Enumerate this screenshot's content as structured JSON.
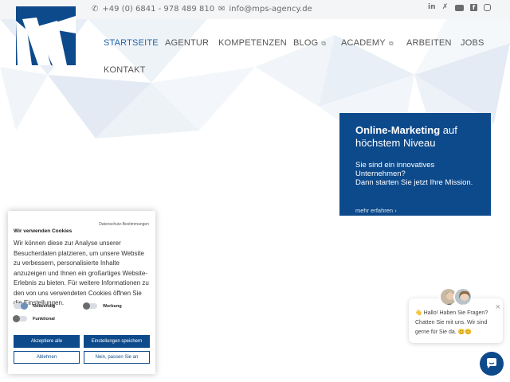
{
  "topbar": {
    "phone": "+49 (0) 6841 - 978 489 810",
    "email": "info@mps-agency.de",
    "social": [
      "linkedin-icon",
      "xing-icon",
      "youtube-icon",
      "facebook-icon",
      "instagram-icon"
    ]
  },
  "nav": {
    "items": [
      {
        "label": "STARTSEITE",
        "active": true
      },
      {
        "label": "AGENTUR"
      },
      {
        "label": "KOMPETENZEN"
      },
      {
        "label": "BLOG",
        "external": true
      },
      {
        "label": "ACADEMY",
        "external": true
      },
      {
        "label": "ARBEITEN"
      },
      {
        "label": "JOBS"
      },
      {
        "label": "KONTAKT"
      }
    ]
  },
  "hero": {
    "title_bold": "Online-Marketing",
    "title_rest": " auf höchstem Niveau",
    "text_line1": "Sie sind ein innovatives Unternehmen?",
    "text_line2": "Dann starten Sie jetzt Ihre Mission.",
    "link": "mehr erfahren",
    "link_arrow": "›"
  },
  "cookie": {
    "policy_link": "Datenschutz-Bestimmungen",
    "title": "Wir verwenden Cookies",
    "text": "Wir können diese zur Analyse unserer Besucherdaten platzieren, um unsere Website zu verbessern, personalisierte Inhalte anzuzeigen und Ihnen ein großartiges Website-Erlebnis zu bieten. Für weitere Informationen zu den von uns verwendeten Cookies öffnen Sie die Einstellungen.",
    "toggles": [
      {
        "label": "Notwendig",
        "on": true
      },
      {
        "label": "Werbung",
        "on": false
      },
      {
        "label": "Funktional",
        "on": false
      }
    ],
    "buttons": {
      "accept_all": "Akzeptiere alle",
      "save_settings": "Einstellungen speichern",
      "decline": "Ablehnen",
      "customize": "Nein, passen Sie an"
    }
  },
  "chat": {
    "message": "👋 Hallo! Haben Sie Fragen? Chatten Sie mit uns. Wir sind gerne für Sie da. 😊😊",
    "close": "×"
  },
  "colors": {
    "brand": "#0d4a8b",
    "nav_active": "#2566a6",
    "topbar_bg": "#f4f5f7"
  }
}
